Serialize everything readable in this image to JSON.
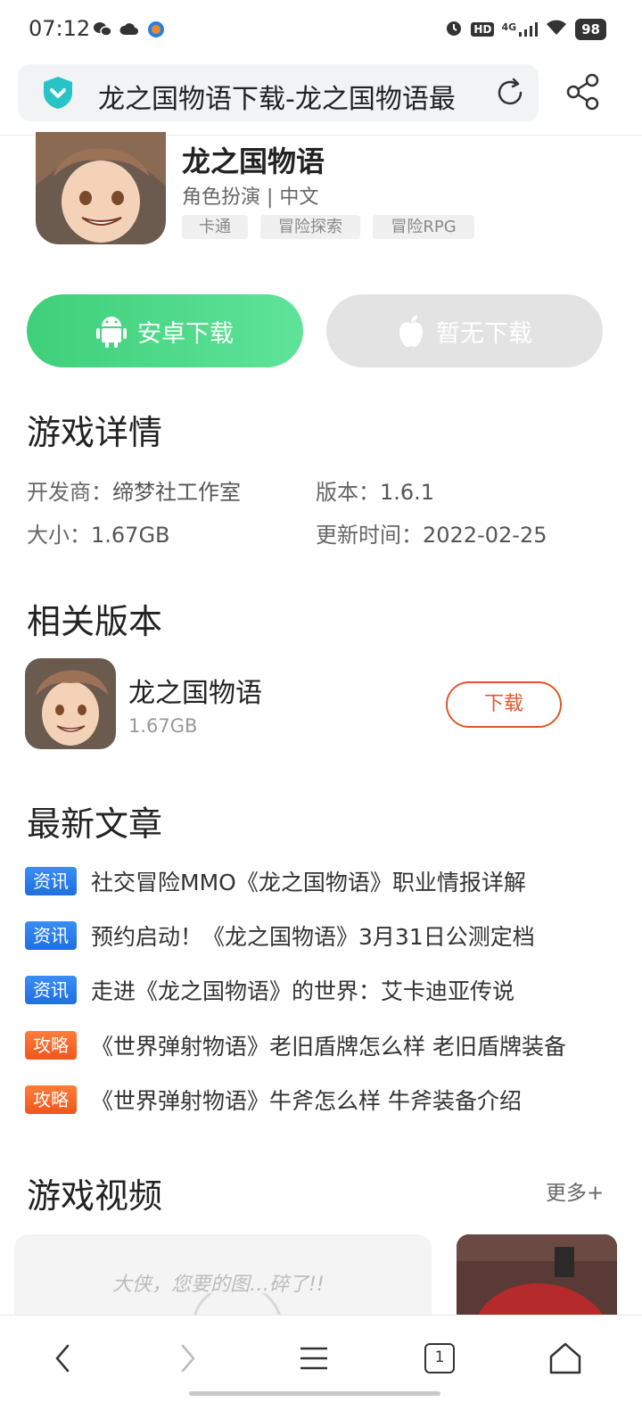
{
  "status_bar": {
    "time": "07:12",
    "network": "4G",
    "hd": "HD",
    "battery": "98"
  },
  "address_bar": {
    "title": "龙之国物语下载-龙之国物语最"
  },
  "app": {
    "name": "龙之国物语",
    "meta": "角色扮演 | 中文",
    "tags": [
      "卡通",
      "冒险探索",
      "冒险RPG"
    ]
  },
  "buttons": {
    "android": "安卓下载",
    "ios": "暂无下载"
  },
  "game_details": {
    "title": "游戏详情",
    "developer_label": "开发商：",
    "developer": "缔梦社工作室",
    "version_label": "版本：",
    "version": "1.6.1",
    "size_label": "大小：",
    "size": "1.67GB",
    "updated_label": "更新时间：",
    "updated": "2022-02-25"
  },
  "related": {
    "title": "相关版本",
    "name": "龙之国物语",
    "size": "1.67GB",
    "download": "下载"
  },
  "articles": {
    "title": "最新文章",
    "items": [
      {
        "badge": "资讯",
        "type": "info",
        "text": "社交冒险MMO《龙之国物语》职业情报详解"
      },
      {
        "badge": "资讯",
        "type": "info",
        "text": "预约启动！《龙之国物语》3月31日公测定档"
      },
      {
        "badge": "资讯",
        "type": "info",
        "text": "走进《龙之国物语》的世界：艾卡迪亚传说"
      },
      {
        "badge": "攻略",
        "type": "guide",
        "text": "《世界弹射物语》老旧盾牌怎么样 老旧盾牌装备"
      },
      {
        "badge": "攻略",
        "type": "guide",
        "text": "《世界弹射物语》牛斧怎么样 牛斧装备介绍"
      }
    ]
  },
  "videos": {
    "title": "游戏视频",
    "more": "更多+",
    "placeholder": "大侠，您要的图…碎了!!"
  },
  "bottom_nav": {
    "tab_count": "1"
  }
}
